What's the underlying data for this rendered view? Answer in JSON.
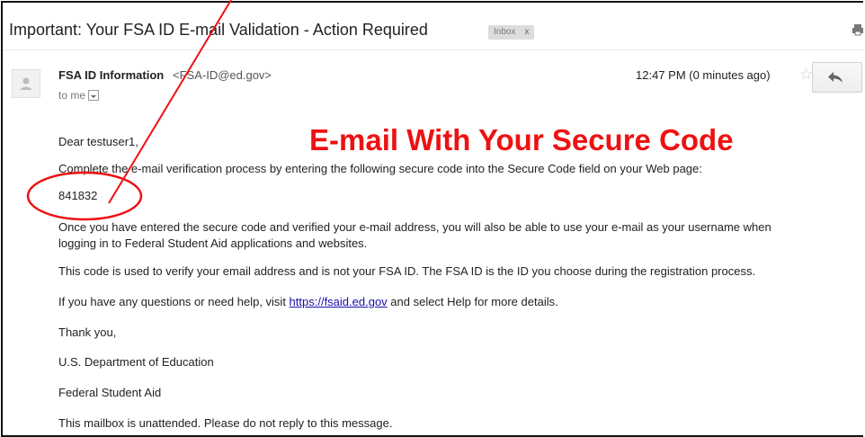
{
  "email": {
    "subject": "Important: Your FSA ID E-mail Validation - Action Required",
    "label": "Inbox",
    "label_remove": "x",
    "sender_name": "FSA ID Information",
    "sender_email": "<FSA-ID@ed.gov>",
    "recipient": "to me",
    "timestamp": "12:47 PM (0 minutes ago)",
    "body": {
      "greeting": "Dear testuser1,",
      "instruction": "Complete the e-mail verification process by entering the following secure code into the Secure Code field on your Web page:",
      "secure_code": "841832",
      "para2_line1": "Once you have entered the secure code and verified your e-mail address, you will also be able to use your e-mail as your username when",
      "para2_line2": "logging in to Federal Student Aid applications and websites.",
      "para3": "This code is used to verify your email address and is not your FSA ID. The FSA ID is the ID you choose during the registration process.",
      "para4_before": "If you have any questions or need help, visit ",
      "para4_link": "https://fsaid.ed.gov",
      "para4_after": " and select Help for more details.",
      "thanks": "Thank you,",
      "org1": "U.S. Department of Education",
      "org2": "Federal Student Aid",
      "footer": "This mailbox is unattended. Please do not reply to this message."
    }
  },
  "annotation": {
    "title": "E-mail With Your Secure Code",
    "color": "#ee1111"
  },
  "icons": {
    "avatar": "avatar-placeholder-icon",
    "star": "star-icon",
    "reply": "reply-icon",
    "print": "print-icon",
    "dropdown": "chevron-down-icon"
  }
}
